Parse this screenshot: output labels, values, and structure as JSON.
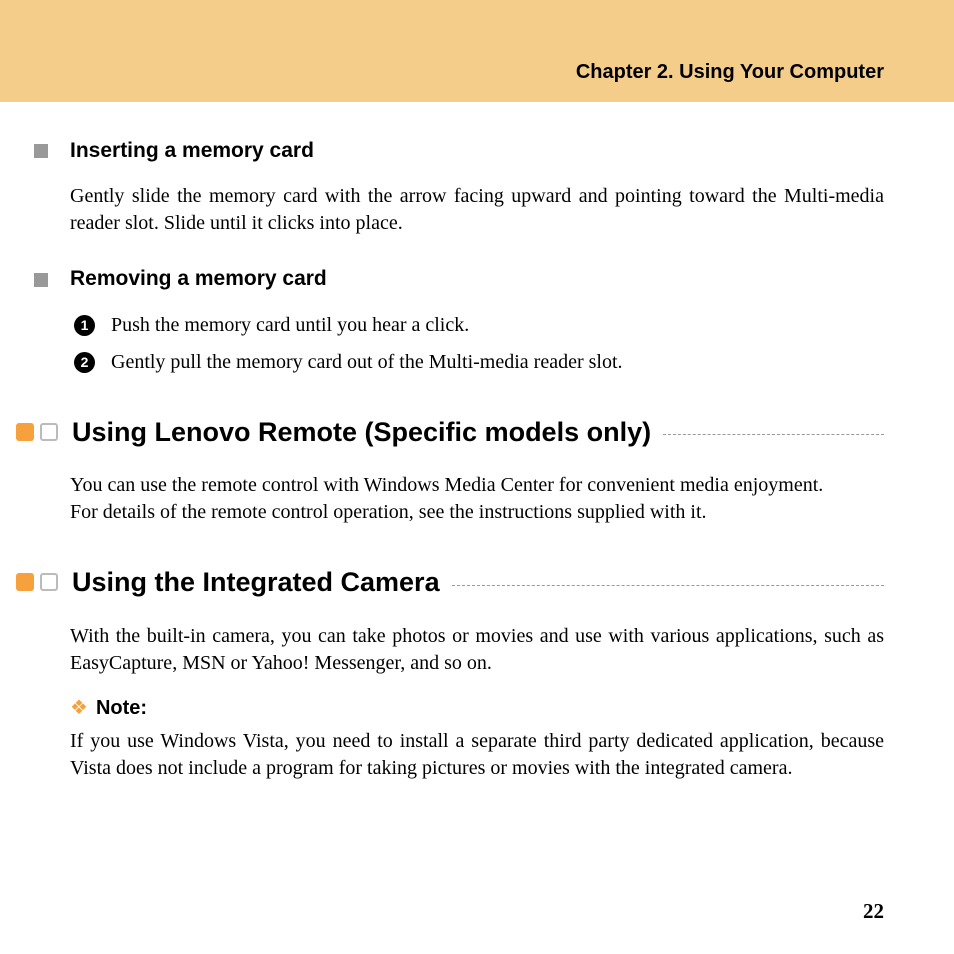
{
  "chapter": "Chapter 2. Using Your Computer",
  "section_insert": {
    "heading": "Inserting a memory card",
    "body": "Gently slide the memory card with the arrow facing upward and pointing toward the Multi-media reader slot. Slide until it clicks into place."
  },
  "section_remove": {
    "heading": "Removing a memory card",
    "steps": [
      "Push the memory card until you hear a click.",
      "Gently pull the memory card out of the Multi-media reader slot."
    ]
  },
  "section_remote": {
    "heading": "Using Lenovo Remote (Specific models only)",
    "body": "You can use the remote control with Windows Media Center for convenient media enjoyment.\nFor details of the remote control operation, see the instructions supplied with it."
  },
  "section_camera": {
    "heading": "Using the Integrated Camera",
    "body": "With the built-in camera, you can take photos or movies and use with various applications, such as EasyCapture, MSN or Yahoo! Messenger, and so on.",
    "note_label": "Note:",
    "note_body": "If you use Windows Vista, you need to install a separate third party dedicated application, because Vista does not include a program for taking pictures or movies with the integrated camera."
  },
  "page_number": "22"
}
